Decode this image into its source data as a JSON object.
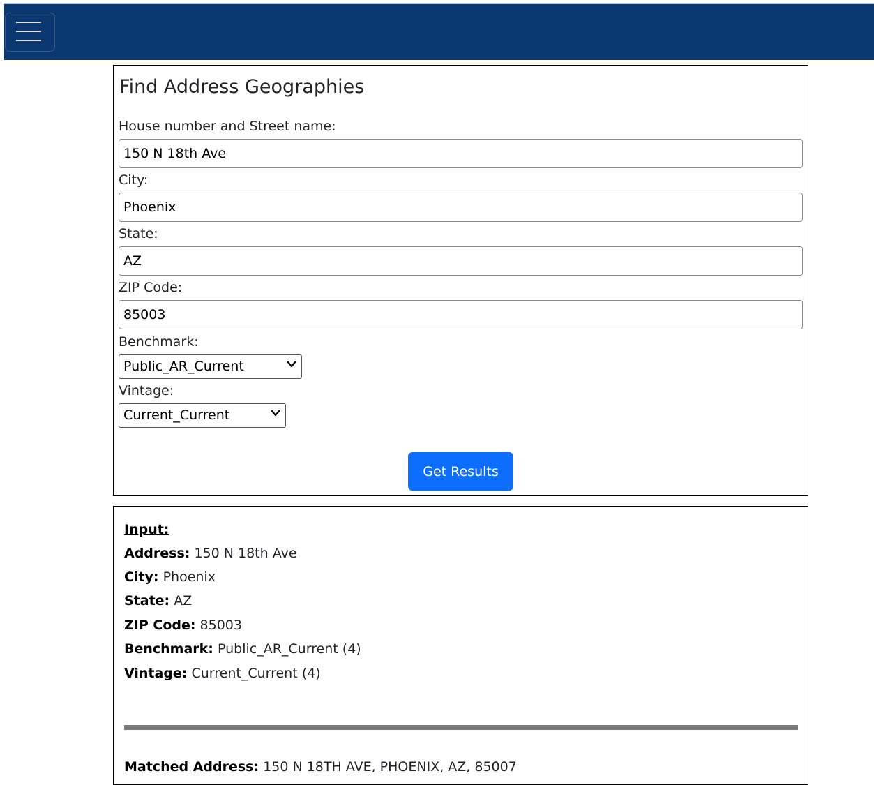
{
  "navbar": {
    "menu_icon": "hamburger-menu-icon",
    "bg_color": "#0b3870"
  },
  "form": {
    "title": "Find Address Geographies",
    "street_label": "House number and Street name:",
    "street_value": "150 N 18th Ave",
    "city_label": "City:",
    "city_value": "Phoenix",
    "state_label": "State:",
    "state_value": "AZ",
    "zip_label": "ZIP Code:",
    "zip_value": "85003",
    "benchmark_label": "Benchmark:",
    "benchmark_selected": "Public_AR_Current",
    "vintage_label": "Vintage:",
    "vintage_selected": "Current_Current",
    "submit_label": "Get Results",
    "submit_color": "#0d6efd"
  },
  "results": {
    "input_heading": "Input:",
    "address_label": "Address:",
    "address_value": "150 N 18th Ave",
    "city_label": "City:",
    "city_value": "Phoenix",
    "state_label": "State:",
    "state_value": "AZ",
    "zip_label": "ZIP Code:",
    "zip_value": "85003",
    "benchmark_label": "Benchmark:",
    "benchmark_value": "Public_AR_Current (4)",
    "vintage_label": "Vintage:",
    "vintage_value": "Current_Current (4)",
    "matched_label": "Matched Address:",
    "matched_value": "150 N 18TH AVE, PHOENIX, AZ, 85007"
  }
}
